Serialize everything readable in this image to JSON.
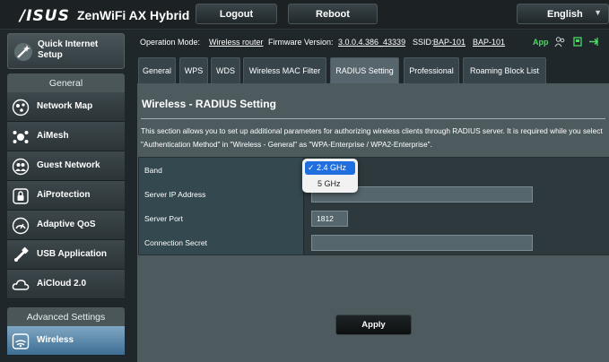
{
  "header": {
    "logo": "/ISUS",
    "product": "ZenWiFi AX Hybrid",
    "logout_label": "Logout",
    "reboot_label": "Reboot",
    "language": "English"
  },
  "sidebar": {
    "quick_setup": "Quick Internet Setup",
    "general_heading": "General",
    "items": [
      {
        "label": "Network Map",
        "icon": "network-map-icon"
      },
      {
        "label": "AiMesh",
        "icon": "aimesh-icon"
      },
      {
        "label": "Guest Network",
        "icon": "guest-network-icon"
      },
      {
        "label": "AiProtection",
        "icon": "lock-icon"
      },
      {
        "label": "Adaptive QoS",
        "icon": "speedometer-icon"
      },
      {
        "label": "USB Application",
        "icon": "usb-icon"
      },
      {
        "label": "AiCloud 2.0",
        "icon": "cloud-icon"
      }
    ],
    "advanced_heading": "Advanced Settings",
    "advanced_items": [
      {
        "label": "Wireless",
        "icon": "wifi-icon",
        "active": true
      }
    ]
  },
  "status": {
    "operation_mode_label": "Operation Mode:",
    "operation_mode": "Wireless router",
    "firmware_label": "Firmware Version:",
    "firmware": "3.0.0.4.386_43339",
    "ssid_label": "SSID:",
    "ssid1": "BAP-101",
    "ssid2": "BAP-101",
    "app_label": "App"
  },
  "tabs": [
    {
      "label": "General"
    },
    {
      "label": "WPS"
    },
    {
      "label": "WDS"
    },
    {
      "label": "Wireless MAC Filter"
    },
    {
      "label": "RADIUS Setting",
      "active": true
    },
    {
      "label": "Professional"
    },
    {
      "label": "Roaming Block List"
    }
  ],
  "panel": {
    "title": "Wireless - RADIUS Setting",
    "description": "This section allows you to set up additional parameters for authorizing wireless clients through RADIUS server. It is required while you select \"Authentication Method\" in \"Wireless - General\" as \"WPA-Enterprise / WPA2-Enterprise\".",
    "fields": {
      "band_label": "Band",
      "server_ip_label": "Server IP Address",
      "server_ip_value": "",
      "server_port_label": "Server Port",
      "server_port_value": "1812",
      "secret_label": "Connection Secret",
      "secret_value": ""
    },
    "apply_label": "Apply"
  },
  "band_dropdown": {
    "selected": "✓ 2.4 GHz",
    "options": [
      "2.4 GHz",
      "5 GHz"
    ],
    "other": "5 GHz"
  },
  "colors": {
    "accent_blue": "#1f6fe0",
    "app_green": "#4cd964",
    "active_menu": "#5e8db3"
  }
}
